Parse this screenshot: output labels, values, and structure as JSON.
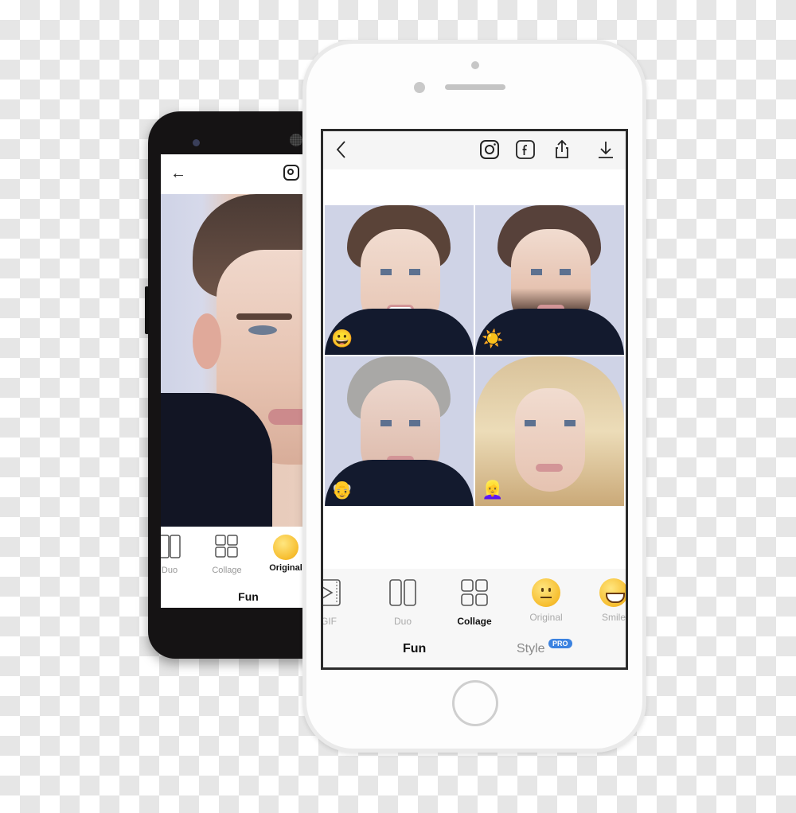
{
  "android": {
    "header": {
      "back_icon": "arrow-left-icon",
      "share_icon": "instagram-icon"
    },
    "toolbar": {
      "items": [
        {
          "label": "Duo",
          "icon": "duo-icon",
          "active": false
        },
        {
          "label": "Collage",
          "icon": "collage-icon",
          "active": false
        },
        {
          "label": "Original",
          "icon": "neutral-face-emoji",
          "active": true
        }
      ],
      "tab": "Fun"
    }
  },
  "iphone": {
    "header": {
      "back_icon": "chevron-left-icon",
      "actions": [
        "instagram-icon",
        "facebook-icon",
        "share-icon",
        "download-icon"
      ]
    },
    "collage": [
      {
        "variant": "smile",
        "emoji": "😀"
      },
      {
        "variant": "beard",
        "emoji": "☀️"
      },
      {
        "variant": "old",
        "emoji": "👴"
      },
      {
        "variant": "female",
        "emoji": "👱‍♀️"
      }
    ],
    "toolbar": {
      "items": [
        {
          "label": "GIF",
          "icon": "gif-icon",
          "active": false
        },
        {
          "label": "Duo",
          "icon": "duo-icon",
          "active": false
        },
        {
          "label": "Collage",
          "icon": "collage-icon",
          "active": true
        },
        {
          "label": "Original",
          "icon": "neutral-face-emoji",
          "active": false
        },
        {
          "label": "Smile",
          "icon": "smile-emoji",
          "active": false
        }
      ],
      "tabs": [
        {
          "label": "Fun",
          "active": true
        },
        {
          "label": "Style",
          "active": false,
          "badge": "PRO"
        }
      ]
    },
    "colors": {
      "pro_badge": "#3b82e0",
      "active_text": "#111111",
      "inactive_text": "#aaaaaa"
    }
  }
}
